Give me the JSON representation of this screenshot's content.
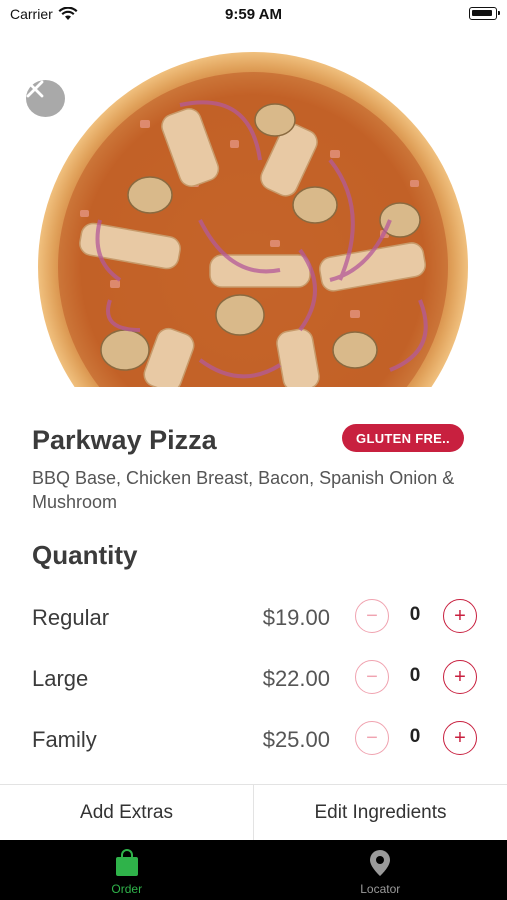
{
  "status_bar": {
    "carrier": "Carrier",
    "time": "9:59 AM"
  },
  "product": {
    "name": "Parkway Pizza",
    "badge": "GLUTEN FRE..",
    "description": "BBQ Base, Chicken Breast, Bacon, Spanish Onion & Mushroom"
  },
  "quantity": {
    "title": "Quantity",
    "sizes": [
      {
        "name": "Regular",
        "price": "$19.00",
        "qty": "0",
        "minus": "−",
        "plus": "+"
      },
      {
        "name": "Large",
        "price": "$22.00",
        "qty": "0",
        "minus": "−",
        "plus": "+"
      },
      {
        "name": "Family",
        "price": "$25.00",
        "qty": "0",
        "minus": "−",
        "plus": "+"
      }
    ]
  },
  "actions": {
    "add_extras": "Add Extras",
    "edit_ingredients": "Edit Ingredients"
  },
  "tabs": [
    {
      "label": "Order",
      "icon": "shopping-bag-icon",
      "active": true,
      "color": "#2fb34a"
    },
    {
      "label": "Locator",
      "icon": "location-pin-icon",
      "active": false,
      "color": "#9a9a9a"
    }
  ],
  "colors": {
    "accent": "#c8203f",
    "accent_light": "#f0a3b0",
    "tab_active": "#2fb34a",
    "tab_inactive": "#9a9a9a"
  }
}
